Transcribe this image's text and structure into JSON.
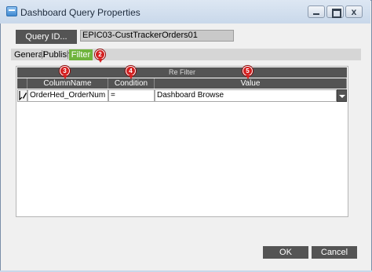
{
  "window": {
    "title": "Dashboard Query Properties",
    "close_glyph": "x"
  },
  "query": {
    "label": "Query ID...",
    "value": "EPIC03-CustTrackerOrders01"
  },
  "tabs": [
    {
      "label": "General"
    },
    {
      "label": "Publish"
    },
    {
      "label": "Filter",
      "active": true
    }
  ],
  "callouts": [
    "2",
    "3",
    "4",
    "5"
  ],
  "grid": {
    "title": "Re Filter",
    "columns": [
      "ColumnName",
      "Condition",
      "Value"
    ],
    "rows": [
      {
        "column_name": "OrderHed_OrderNum",
        "condition": "=",
        "value": "Dashboard Browse"
      }
    ]
  },
  "buttons": {
    "ok": "OK",
    "cancel": "Cancel"
  },
  "colors": {
    "accent_tab": "#6fb43d",
    "callout": "#d42020",
    "dark_header": "#545454"
  }
}
